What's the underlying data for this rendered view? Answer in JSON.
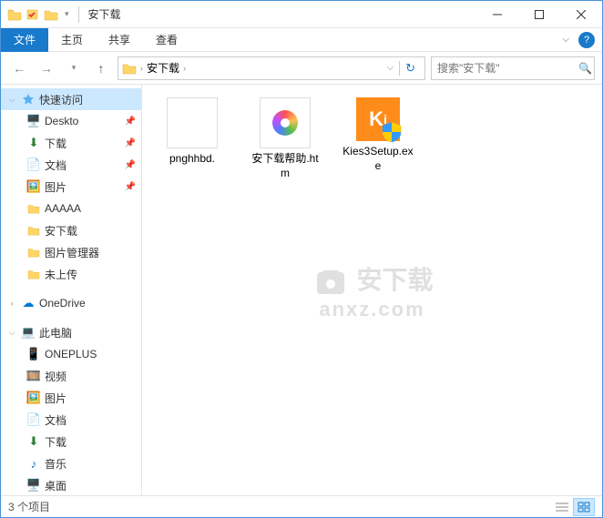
{
  "titlebar": {
    "title": "安下载"
  },
  "ribbon": {
    "file": "文件",
    "home": "主页",
    "share": "共享",
    "view": "查看"
  },
  "nav": {
    "breadcrumb_root_sep": "›",
    "breadcrumb": "安下载",
    "breadcrumb_sep": "›",
    "search_placeholder": "搜索\"安下载\""
  },
  "sidebar": {
    "quick_access": "快速访问",
    "items": [
      {
        "label": "Deskto",
        "icon": "desktop",
        "pinned": true
      },
      {
        "label": "下载",
        "icon": "downloads",
        "pinned": true
      },
      {
        "label": "文档",
        "icon": "documents",
        "pinned": true
      },
      {
        "label": "图片",
        "icon": "pictures",
        "pinned": true
      },
      {
        "label": "AAAAA",
        "icon": "folder",
        "pinned": false
      },
      {
        "label": "安下载",
        "icon": "folder",
        "pinned": false
      },
      {
        "label": "图片管理器",
        "icon": "folder",
        "pinned": false
      },
      {
        "label": "未上传",
        "icon": "folder",
        "pinned": false
      }
    ],
    "onedrive": "OneDrive",
    "this_pc": "此电脑",
    "pc_items": [
      {
        "label": "ONEPLUS",
        "icon": "device"
      },
      {
        "label": "视频",
        "icon": "videos"
      },
      {
        "label": "图片",
        "icon": "pictures"
      },
      {
        "label": "文档",
        "icon": "documents"
      },
      {
        "label": "下载",
        "icon": "downloads"
      },
      {
        "label": "音乐",
        "icon": "music"
      },
      {
        "label": "桌面",
        "icon": "desktop"
      }
    ]
  },
  "files": [
    {
      "name": "pnghhbd.",
      "type": "blank"
    },
    {
      "name": "安下载帮助.htm",
      "type": "htm"
    },
    {
      "name": "Kies3Setup.exe",
      "type": "exe"
    }
  ],
  "statusbar": {
    "count": "3 个项目"
  },
  "watermark": {
    "line1": "安下载",
    "line2": "anxz.com"
  }
}
